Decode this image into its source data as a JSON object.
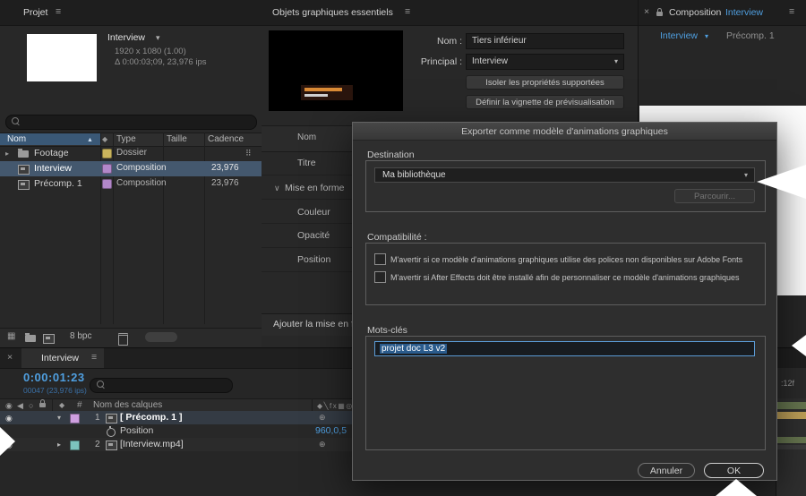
{
  "colors": {
    "accent_blue": "#4f9fe0",
    "timecode_blue": "#4f9fe0",
    "selection_row": "#44586e",
    "chip_yellow": "#c9b45c",
    "chip_lavender": "#b287c9",
    "swatch_pink": "#cf9fe0",
    "swatch_teal": "#7cc4bd",
    "bar_green": "#66754f",
    "bar_tan": "#bfa058",
    "comp_background": "#fbfbfb"
  },
  "icons": {
    "close": "×",
    "menu": "≡",
    "caret_down": "▾",
    "caret_right": "▸",
    "chevron_down": "∨",
    "sort_up": "▲",
    "eye": "◉",
    "audio": "◀",
    "solo": "○",
    "label_tag": "◆",
    "hash": "#",
    "plus_circle": "⊕",
    "share": "⠿",
    "grid": "▦",
    "switches": "◆╲fx▦◎"
  },
  "project": {
    "tab": "Projet",
    "item": {
      "name": "Interview",
      "line1": "1920 x 1080 (1.00)",
      "line2": "Δ 0:00:03;09, 23,976 ips"
    },
    "columns": {
      "nom": "Nom",
      "type": "Type",
      "taille": "Taille",
      "cadence": "Cadence"
    },
    "rows": [
      {
        "name": "Footage",
        "type": "Dossier",
        "cadence": ""
      },
      {
        "name": "Interview",
        "type": "Composition",
        "cadence": "23,976"
      },
      {
        "name": "Précomp. 1",
        "type": "Composition",
        "cadence": "23,976"
      }
    ],
    "bpc": "8 bpc"
  },
  "essential": {
    "title": "Objets graphiques essentiels",
    "nom_label": "Nom :",
    "nom_value": "Tiers inférieur",
    "principal_label": "Principal :",
    "principal_value": "Interview",
    "isolate_button": "Isoler les propriétés supportées",
    "thumbnail_button": "Définir la vignette de prévisualisation",
    "list_header": "Nom",
    "props": {
      "titre": "Titre",
      "mise_en_forme": "Mise en forme",
      "couleur": "Couleur",
      "opacite": "Opacité",
      "position": "Position"
    },
    "add_button": "Ajouter la mise en f"
  },
  "comp": {
    "title_prefix": "Composition",
    "title_name": "Interview",
    "tab_active": "Interview",
    "tab_other": "Précomp. 1"
  },
  "dialog": {
    "title": "Exporter comme modèle d'animations graphiques",
    "destination_label": "Destination",
    "destination_value": "Ma bibliothèque",
    "browse_button": "Parcourir...",
    "compat_label": "Compatibilité :",
    "warn_fonts": "M'avertir si ce modèle d'animations graphiques utilise des polices non disponibles sur Adobe Fonts",
    "warn_installed": "M'avertir si After Effects doit être installé afin de personnaliser ce modèle d'animations graphiques",
    "keywords_label": "Mots-clés",
    "keywords_value": "projet doc L3 v2",
    "cancel_button": "Annuler",
    "ok_button": "OK"
  },
  "timeline": {
    "tab": "Interview",
    "timecode": "0:00:01:23",
    "frame_info": "00047 (23,976 ips)",
    "name_column": "Nom des calques",
    "layer1": {
      "num": "1",
      "name": "[ Précomp. 1 ]"
    },
    "property": {
      "name": "Position",
      "value": "960,0,5"
    },
    "layer2": {
      "num": "2",
      "name": "[Interview.mp4]"
    },
    "ruler_label": ":12f"
  }
}
